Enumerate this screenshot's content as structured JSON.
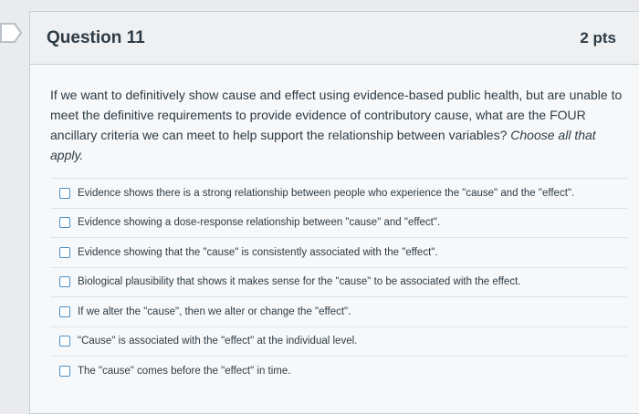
{
  "question": {
    "title": "Question 11",
    "points": "2 pts",
    "text_main": "If we want to definitively show cause and effect using evidence-based public health, but are unable to meet the definitive requirements to provide evidence of contributory cause, what are the FOUR ancillary criteria we can meet to help support the relationship between variables?",
    "text_hint": "Choose all that apply."
  },
  "answers": [
    {
      "label": "Evidence shows there is a strong relationship between people who experience the \"cause\" and the \"effect\"."
    },
    {
      "label": "Evidence showing a dose-response relationship between \"cause\" and \"effect\"."
    },
    {
      "label": "Evidence showing that the \"cause\" is consistently associated with the \"effect\"."
    },
    {
      "label": "Biological plausibility that shows it makes sense for the \"cause\" to be associated with the effect."
    },
    {
      "label": "If we alter the \"cause\", then we alter or change the \"effect\"."
    },
    {
      "label": "\"Cause\" is associated with the \"effect\" at the individual level."
    },
    {
      "label": "The \"cause\" comes before the \"effect\" in time."
    }
  ]
}
